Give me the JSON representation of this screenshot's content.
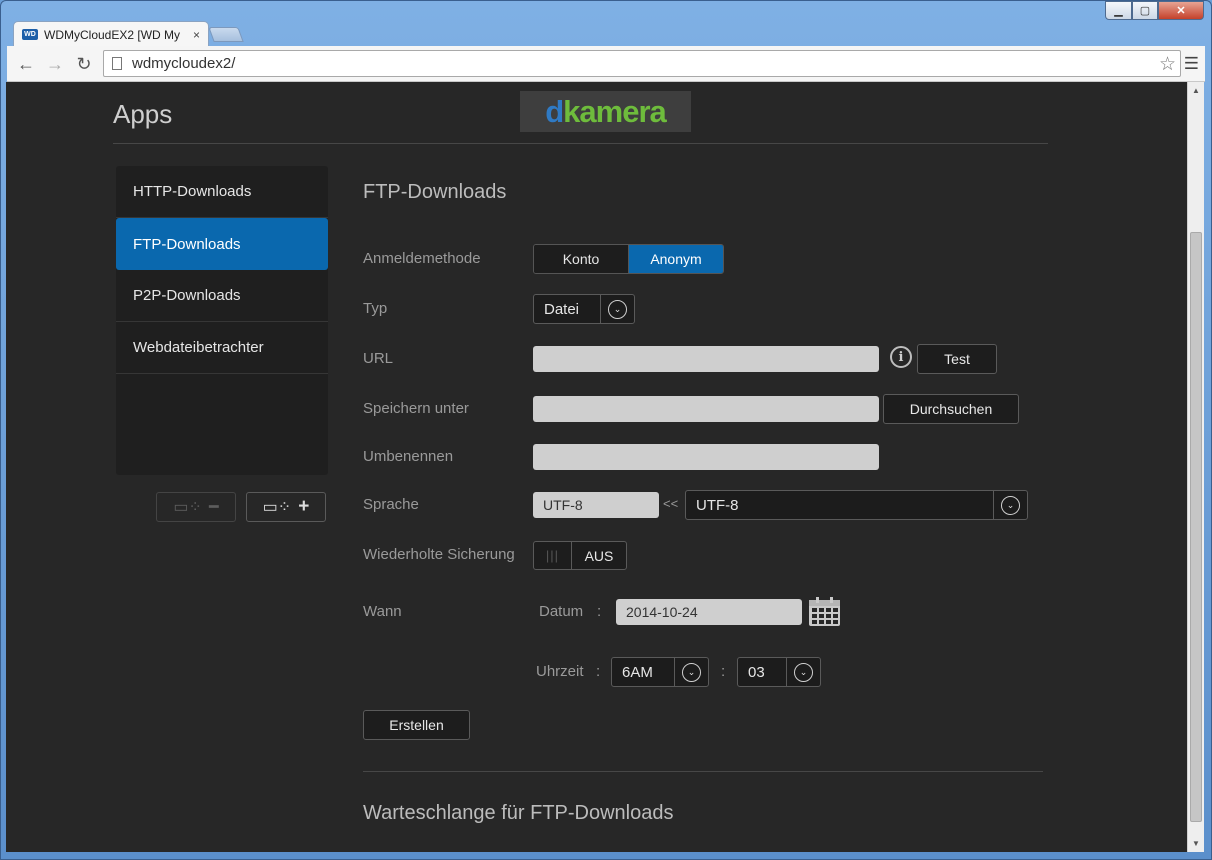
{
  "browser": {
    "tab_title": "WDMyCloudEX2 [WD My",
    "tab_favicon": "WD",
    "tab_close": "×",
    "url": "wdmycloudex2/"
  },
  "header": {
    "title": "Apps",
    "logo": {
      "d": "d",
      "rest": "kamera"
    }
  },
  "sidebar": {
    "items": [
      {
        "label": "HTTP-Downloads",
        "active": false
      },
      {
        "label": "FTP-Downloads",
        "active": true
      },
      {
        "label": "P2P-Downloads",
        "active": false
      },
      {
        "label": "Webdateibetrachter",
        "active": false
      }
    ]
  },
  "form": {
    "section_title": "FTP-Downloads",
    "login_label": "Anmeldemethode",
    "login_options": [
      "Konto",
      "Anonym"
    ],
    "login_selected": "Anonym",
    "type_label": "Typ",
    "type_value": "Datei",
    "url_label": "URL",
    "url_value": "",
    "test_button": "Test",
    "save_label": "Speichern unter",
    "save_value": "",
    "browse_button": "Durchsuchen",
    "rename_label": "Umbenennen",
    "rename_value": "",
    "language_label": "Sprache",
    "language_input": "UTF-8",
    "language_arrow": "<<",
    "language_select": "UTF-8",
    "backup_label": "Wiederholte Sicherung",
    "backup_state": "AUS",
    "when_label": "Wann",
    "date_label": "Datum",
    "date_sep": ":",
    "date_value": "2014-10-24",
    "time_label": "Uhrzeit",
    "time_sep": ":",
    "hour_value": "6AM",
    "minute_sep": ":",
    "minute_value": "03",
    "create_button": "Erstellen"
  },
  "queue": {
    "title": "Warteschlange für FTP-Downloads"
  },
  "colors": {
    "accent": "#0a68ae",
    "background": "#272727",
    "logo_green": "#6ebc3c",
    "logo_blue": "#2f7ac4"
  }
}
